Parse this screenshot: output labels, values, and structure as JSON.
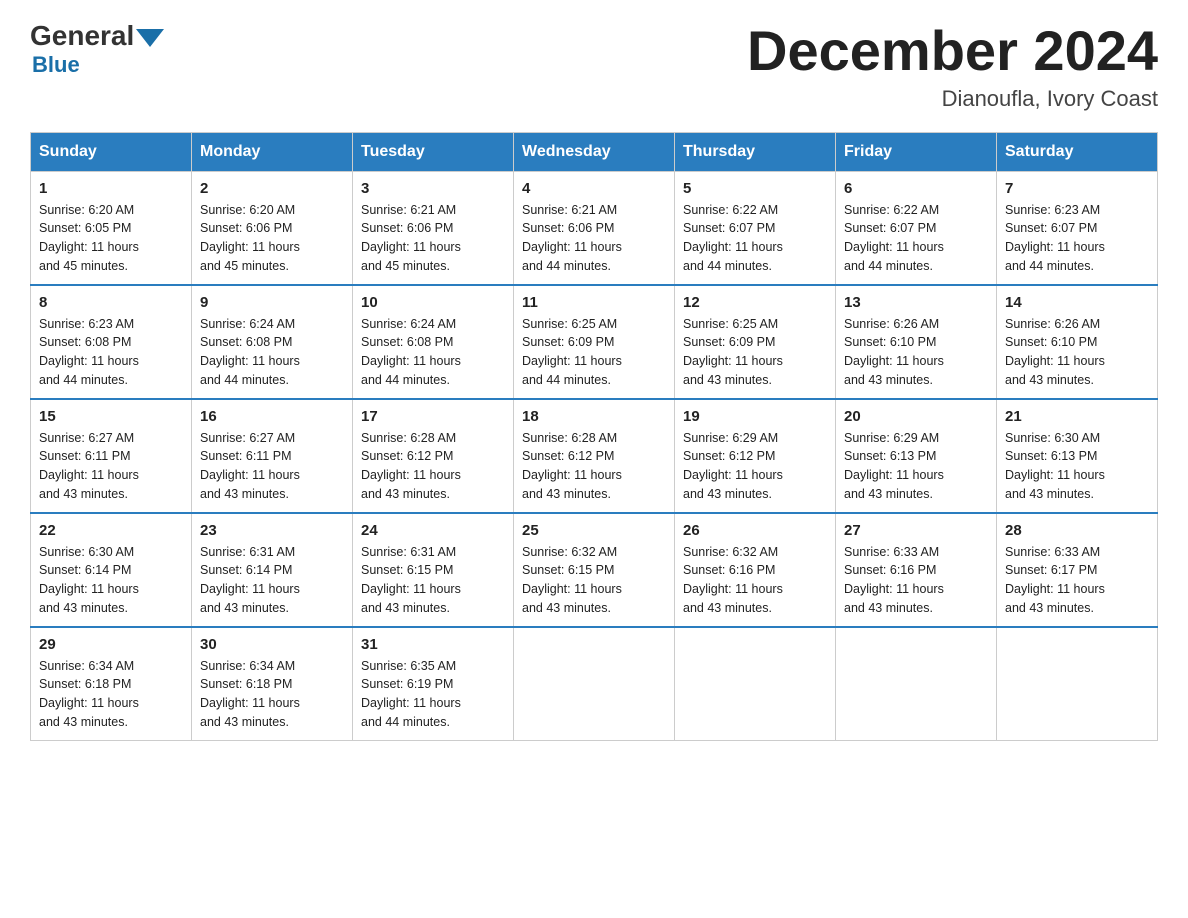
{
  "header": {
    "logo_general": "General",
    "logo_blue": "Blue",
    "month_title": "December 2024",
    "location": "Dianoufla, Ivory Coast"
  },
  "days_of_week": [
    "Sunday",
    "Monday",
    "Tuesday",
    "Wednesday",
    "Thursday",
    "Friday",
    "Saturday"
  ],
  "weeks": [
    [
      {
        "day": "1",
        "sunrise": "6:20 AM",
        "sunset": "6:05 PM",
        "daylight": "11 hours and 45 minutes."
      },
      {
        "day": "2",
        "sunrise": "6:20 AM",
        "sunset": "6:06 PM",
        "daylight": "11 hours and 45 minutes."
      },
      {
        "day": "3",
        "sunrise": "6:21 AM",
        "sunset": "6:06 PM",
        "daylight": "11 hours and 45 minutes."
      },
      {
        "day": "4",
        "sunrise": "6:21 AM",
        "sunset": "6:06 PM",
        "daylight": "11 hours and 44 minutes."
      },
      {
        "day": "5",
        "sunrise": "6:22 AM",
        "sunset": "6:07 PM",
        "daylight": "11 hours and 44 minutes."
      },
      {
        "day": "6",
        "sunrise": "6:22 AM",
        "sunset": "6:07 PM",
        "daylight": "11 hours and 44 minutes."
      },
      {
        "day": "7",
        "sunrise": "6:23 AM",
        "sunset": "6:07 PM",
        "daylight": "11 hours and 44 minutes."
      }
    ],
    [
      {
        "day": "8",
        "sunrise": "6:23 AM",
        "sunset": "6:08 PM",
        "daylight": "11 hours and 44 minutes."
      },
      {
        "day": "9",
        "sunrise": "6:24 AM",
        "sunset": "6:08 PM",
        "daylight": "11 hours and 44 minutes."
      },
      {
        "day": "10",
        "sunrise": "6:24 AM",
        "sunset": "6:08 PM",
        "daylight": "11 hours and 44 minutes."
      },
      {
        "day": "11",
        "sunrise": "6:25 AM",
        "sunset": "6:09 PM",
        "daylight": "11 hours and 44 minutes."
      },
      {
        "day": "12",
        "sunrise": "6:25 AM",
        "sunset": "6:09 PM",
        "daylight": "11 hours and 43 minutes."
      },
      {
        "day": "13",
        "sunrise": "6:26 AM",
        "sunset": "6:10 PM",
        "daylight": "11 hours and 43 minutes."
      },
      {
        "day": "14",
        "sunrise": "6:26 AM",
        "sunset": "6:10 PM",
        "daylight": "11 hours and 43 minutes."
      }
    ],
    [
      {
        "day": "15",
        "sunrise": "6:27 AM",
        "sunset": "6:11 PM",
        "daylight": "11 hours and 43 minutes."
      },
      {
        "day": "16",
        "sunrise": "6:27 AM",
        "sunset": "6:11 PM",
        "daylight": "11 hours and 43 minutes."
      },
      {
        "day": "17",
        "sunrise": "6:28 AM",
        "sunset": "6:12 PM",
        "daylight": "11 hours and 43 minutes."
      },
      {
        "day": "18",
        "sunrise": "6:28 AM",
        "sunset": "6:12 PM",
        "daylight": "11 hours and 43 minutes."
      },
      {
        "day": "19",
        "sunrise": "6:29 AM",
        "sunset": "6:12 PM",
        "daylight": "11 hours and 43 minutes."
      },
      {
        "day": "20",
        "sunrise": "6:29 AM",
        "sunset": "6:13 PM",
        "daylight": "11 hours and 43 minutes."
      },
      {
        "day": "21",
        "sunrise": "6:30 AM",
        "sunset": "6:13 PM",
        "daylight": "11 hours and 43 minutes."
      }
    ],
    [
      {
        "day": "22",
        "sunrise": "6:30 AM",
        "sunset": "6:14 PM",
        "daylight": "11 hours and 43 minutes."
      },
      {
        "day": "23",
        "sunrise": "6:31 AM",
        "sunset": "6:14 PM",
        "daylight": "11 hours and 43 minutes."
      },
      {
        "day": "24",
        "sunrise": "6:31 AM",
        "sunset": "6:15 PM",
        "daylight": "11 hours and 43 minutes."
      },
      {
        "day": "25",
        "sunrise": "6:32 AM",
        "sunset": "6:15 PM",
        "daylight": "11 hours and 43 minutes."
      },
      {
        "day": "26",
        "sunrise": "6:32 AM",
        "sunset": "6:16 PM",
        "daylight": "11 hours and 43 minutes."
      },
      {
        "day": "27",
        "sunrise": "6:33 AM",
        "sunset": "6:16 PM",
        "daylight": "11 hours and 43 minutes."
      },
      {
        "day": "28",
        "sunrise": "6:33 AM",
        "sunset": "6:17 PM",
        "daylight": "11 hours and 43 minutes."
      }
    ],
    [
      {
        "day": "29",
        "sunrise": "6:34 AM",
        "sunset": "6:18 PM",
        "daylight": "11 hours and 43 minutes."
      },
      {
        "day": "30",
        "sunrise": "6:34 AM",
        "sunset": "6:18 PM",
        "daylight": "11 hours and 43 minutes."
      },
      {
        "day": "31",
        "sunrise": "6:35 AM",
        "sunset": "6:19 PM",
        "daylight": "11 hours and 44 minutes."
      },
      null,
      null,
      null,
      null
    ]
  ],
  "labels": {
    "sunrise": "Sunrise:",
    "sunset": "Sunset:",
    "daylight": "Daylight:"
  }
}
